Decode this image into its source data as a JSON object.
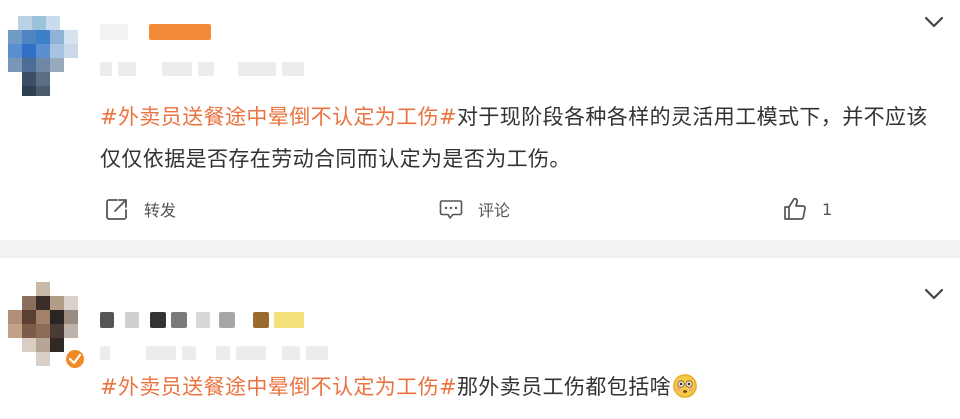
{
  "posts": [
    {
      "hashtag": "#外卖员送餐途中晕倒不认定为工伤#",
      "text": "对于现阶段各种各样的灵活用工模式下，并不应该仅仅依据是否存在劳动合同而认定为是否为工伤。",
      "actions": {
        "repost_label": "转发",
        "comment_label": "评论",
        "like_count": "1"
      }
    },
    {
      "hashtag": "#外卖员送餐途中晕倒不认定为工伤#",
      "text": "那外卖员工伤都包括啥"
    }
  ],
  "icons": {
    "more": "chevron-down-icon",
    "repost": "share-icon",
    "comment": "comment-icon",
    "like": "thumbs-up-icon",
    "emoji": "flushed-face-emoji",
    "verified": "verified-badge-icon"
  },
  "colors": {
    "hashtag": "#eb7340",
    "text": "#333333",
    "action_text": "#555555",
    "separator": "#f2f2f2",
    "verified_badge": "#f08a24"
  }
}
